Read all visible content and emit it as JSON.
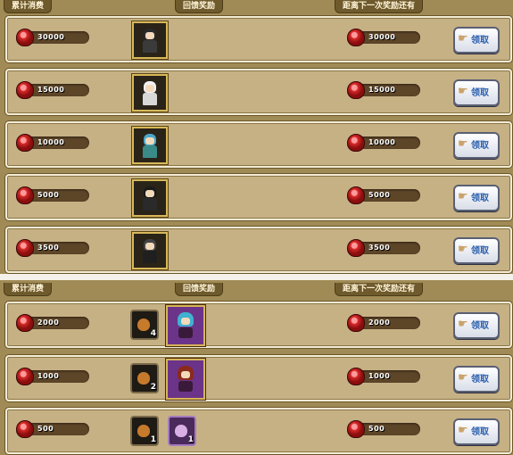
{
  "headers": {
    "cumulative": "累计消费",
    "reward": "回馈奖励",
    "remaining": "距离下一次奖励还有"
  },
  "claim_label": "领取",
  "top_rows": [
    {
      "amount": "30000",
      "remaining": "30000",
      "hair": "#2a2a2a",
      "outfit": "#3b3b3b"
    },
    {
      "amount": "15000",
      "remaining": "15000",
      "hair": "#f2f2f2",
      "outfit": "#d8d8d8"
    },
    {
      "amount": "10000",
      "remaining": "10000",
      "hair": "#4aa7c9",
      "outfit": "#3a8a88"
    },
    {
      "amount": "5000",
      "remaining": "5000",
      "hair": "#1a1a1a",
      "outfit": "#2a2a2a"
    },
    {
      "amount": "3500",
      "remaining": "3500",
      "hair": "#444444",
      "outfit": "#1f1f1f"
    }
  ],
  "bottom_rows": [
    {
      "amount": "2000",
      "remaining": "2000",
      "item_qty": "4",
      "second": "character",
      "hair": "#3fb2d0"
    },
    {
      "amount": "1000",
      "remaining": "1000",
      "item_qty": "2",
      "second": "character",
      "hair": "#8a2a1a"
    },
    {
      "amount": "500",
      "remaining": "500",
      "item_qty": "1",
      "second": "bag",
      "second_qty": "1"
    }
  ]
}
